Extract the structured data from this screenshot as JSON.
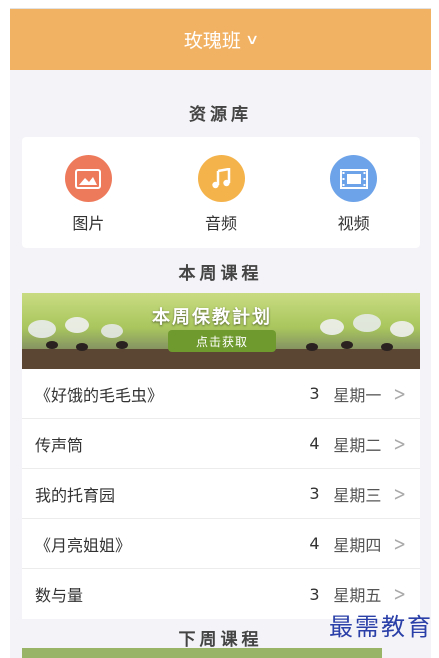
{
  "header": {
    "class_name": "玫瑰班",
    "chevron": "∨"
  },
  "resources": {
    "title": "资源库",
    "items": [
      {
        "label": "图片",
        "icon": "image-icon",
        "color": "#ee7a5c"
      },
      {
        "label": "音频",
        "icon": "music-note-icon",
        "color": "#f4b34b"
      },
      {
        "label": "视频",
        "icon": "film-icon",
        "color": "#6da3e8"
      }
    ]
  },
  "this_week": {
    "title": "本周课程",
    "banner": {
      "title": "本周保教計划",
      "button": "点击获取"
    },
    "courses": [
      {
        "name": "《好饿的毛毛虫》",
        "count": "3",
        "day": "星期一"
      },
      {
        "name": "传声筒",
        "count": "4",
        "day": "星期二"
      },
      {
        "name": "我的托育园",
        "count": "3",
        "day": "星期三"
      },
      {
        "name": "《月亮姐姐》",
        "count": "4",
        "day": "星期四"
      },
      {
        "name": "数与量",
        "count": "3",
        "day": "星期五"
      }
    ]
  },
  "next_week": {
    "title": "下周课程"
  },
  "watermark": "最需教育",
  "colors": {
    "header": "#f2b264",
    "background": "#f4f3f7"
  }
}
